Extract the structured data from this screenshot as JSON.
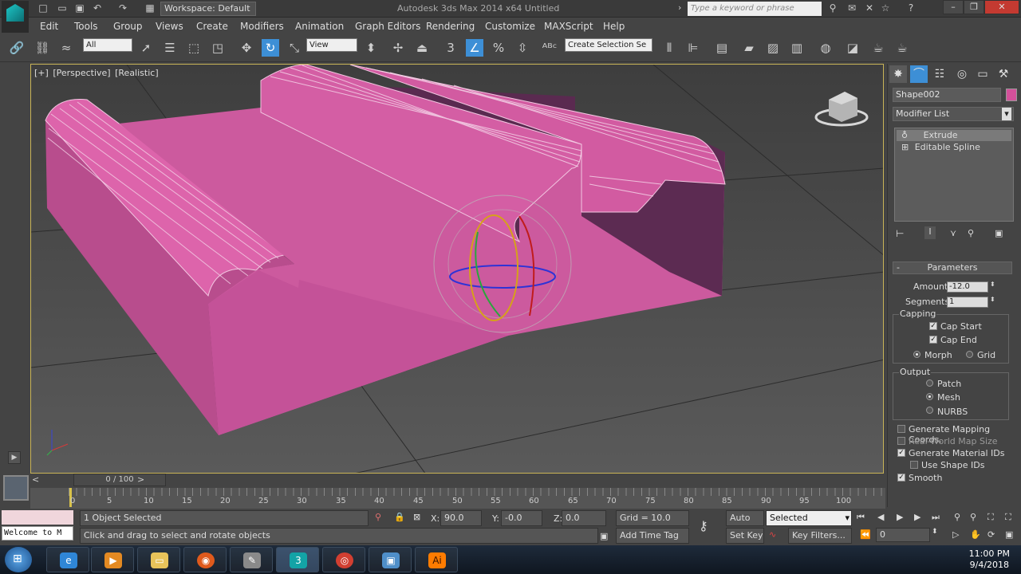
{
  "titlebar": {
    "workspace": "Workspace: Default",
    "app_title": "Autodesk 3ds Max  2014 x64     Untitled",
    "search_placeholder": "Type a keyword or phrase"
  },
  "menu": [
    "Edit",
    "Tools",
    "Group",
    "Views",
    "Create",
    "Modifiers",
    "Animation",
    "Graph Editors",
    "Rendering",
    "Customize",
    "MAXScript",
    "Help"
  ],
  "toolbar": {
    "filter_select": "All",
    "ref_coord_select": "View",
    "selection_set": "Create Selection Se",
    "snap_label": "3",
    "angle_label": "%"
  },
  "viewport": {
    "labels": [
      "[+]",
      "[Perspective]",
      "[Realistic]"
    ]
  },
  "command_panel": {
    "object_name": "Shape002",
    "object_color": "#d4509a",
    "modifier_list": "Modifier List",
    "stack": [
      "Extrude",
      "Editable Spline"
    ],
    "parameters_title": "Parameters",
    "amount_label": "Amount:",
    "amount_value": "-12.0",
    "segments_label": "Segments:",
    "segments_value": "1",
    "capping_title": "Capping",
    "cap_start": "Cap Start",
    "cap_end": "Cap End",
    "morph": "Morph",
    "grid": "Grid",
    "output_title": "Output",
    "patch": "Patch",
    "mesh": "Mesh",
    "nurbs": "NURBS",
    "gen_mapping": "Generate Mapping Coords.",
    "real_world": "Real-World Map Size",
    "gen_material": "Generate Material IDs",
    "use_shape": "Use Shape IDs",
    "smooth": "Smooth"
  },
  "timeline": {
    "frame_display": "0 / 100",
    "ticks": [
      "0",
      "5",
      "10",
      "15",
      "20",
      "25",
      "30",
      "35",
      "40",
      "45",
      "50",
      "55",
      "60",
      "65",
      "70",
      "75",
      "80",
      "85",
      "90",
      "95",
      "100"
    ]
  },
  "status": {
    "maxscript": "Welcome to M",
    "selected_count": "1 Object Selected",
    "prompt": "Click and drag to select and rotate objects",
    "x_label": "X:",
    "x_value": "90.0",
    "y_label": "Y:",
    "y_value": "-0.0",
    "z_label": "Z:",
    "z_value": "0.0",
    "grid": "Grid = 10.0",
    "add_time_tag": "Add Time Tag",
    "auto_key": "Auto Key",
    "set_key": "Set Key",
    "selected_dropdown": "Selected",
    "key_filters": "Key Filters...",
    "frame_value": "0"
  },
  "taskbar": {
    "time": "11:00 PM",
    "date": "9/4/2018",
    "apps": [
      "ie-icon",
      "media-icon",
      "explorer-icon",
      "firefox-icon",
      "paint-icon",
      "3dsmax-icon",
      "chrome-icon",
      "photo-icon",
      "illustrator-icon"
    ]
  }
}
